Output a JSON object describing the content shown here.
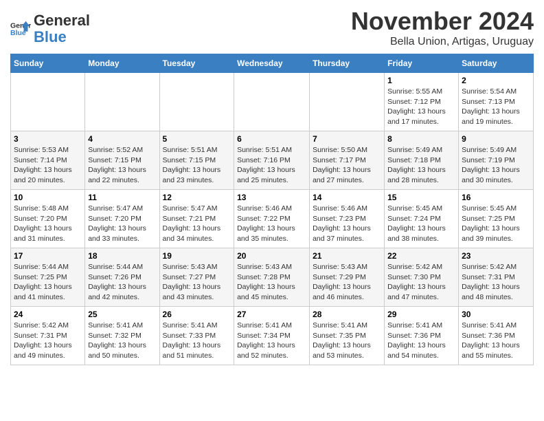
{
  "logo": {
    "general": "General",
    "blue": "Blue"
  },
  "header": {
    "month_title": "November 2024",
    "subtitle": "Bella Union, Artigas, Uruguay"
  },
  "days_of_week": [
    "Sunday",
    "Monday",
    "Tuesday",
    "Wednesday",
    "Thursday",
    "Friday",
    "Saturday"
  ],
  "weeks": [
    [
      {
        "day": "",
        "sunrise": "",
        "sunset": "",
        "daylight": ""
      },
      {
        "day": "",
        "sunrise": "",
        "sunset": "",
        "daylight": ""
      },
      {
        "day": "",
        "sunrise": "",
        "sunset": "",
        "daylight": ""
      },
      {
        "day": "",
        "sunrise": "",
        "sunset": "",
        "daylight": ""
      },
      {
        "day": "",
        "sunrise": "",
        "sunset": "",
        "daylight": ""
      },
      {
        "day": "1",
        "sunrise": "5:55 AM",
        "sunset": "7:12 PM",
        "daylight": "13 hours and 17 minutes."
      },
      {
        "day": "2",
        "sunrise": "5:54 AM",
        "sunset": "7:13 PM",
        "daylight": "13 hours and 19 minutes."
      }
    ],
    [
      {
        "day": "3",
        "sunrise": "5:53 AM",
        "sunset": "7:14 PM",
        "daylight": "13 hours and 20 minutes."
      },
      {
        "day": "4",
        "sunrise": "5:52 AM",
        "sunset": "7:15 PM",
        "daylight": "13 hours and 22 minutes."
      },
      {
        "day": "5",
        "sunrise": "5:51 AM",
        "sunset": "7:15 PM",
        "daylight": "13 hours and 23 minutes."
      },
      {
        "day": "6",
        "sunrise": "5:51 AM",
        "sunset": "7:16 PM",
        "daylight": "13 hours and 25 minutes."
      },
      {
        "day": "7",
        "sunrise": "5:50 AM",
        "sunset": "7:17 PM",
        "daylight": "13 hours and 27 minutes."
      },
      {
        "day": "8",
        "sunrise": "5:49 AM",
        "sunset": "7:18 PM",
        "daylight": "13 hours and 28 minutes."
      },
      {
        "day": "9",
        "sunrise": "5:49 AM",
        "sunset": "7:19 PM",
        "daylight": "13 hours and 30 minutes."
      }
    ],
    [
      {
        "day": "10",
        "sunrise": "5:48 AM",
        "sunset": "7:20 PM",
        "daylight": "13 hours and 31 minutes."
      },
      {
        "day": "11",
        "sunrise": "5:47 AM",
        "sunset": "7:20 PM",
        "daylight": "13 hours and 33 minutes."
      },
      {
        "day": "12",
        "sunrise": "5:47 AM",
        "sunset": "7:21 PM",
        "daylight": "13 hours and 34 minutes."
      },
      {
        "day": "13",
        "sunrise": "5:46 AM",
        "sunset": "7:22 PM",
        "daylight": "13 hours and 35 minutes."
      },
      {
        "day": "14",
        "sunrise": "5:46 AM",
        "sunset": "7:23 PM",
        "daylight": "13 hours and 37 minutes."
      },
      {
        "day": "15",
        "sunrise": "5:45 AM",
        "sunset": "7:24 PM",
        "daylight": "13 hours and 38 minutes."
      },
      {
        "day": "16",
        "sunrise": "5:45 AM",
        "sunset": "7:25 PM",
        "daylight": "13 hours and 39 minutes."
      }
    ],
    [
      {
        "day": "17",
        "sunrise": "5:44 AM",
        "sunset": "7:25 PM",
        "daylight": "13 hours and 41 minutes."
      },
      {
        "day": "18",
        "sunrise": "5:44 AM",
        "sunset": "7:26 PM",
        "daylight": "13 hours and 42 minutes."
      },
      {
        "day": "19",
        "sunrise": "5:43 AM",
        "sunset": "7:27 PM",
        "daylight": "13 hours and 43 minutes."
      },
      {
        "day": "20",
        "sunrise": "5:43 AM",
        "sunset": "7:28 PM",
        "daylight": "13 hours and 45 minutes."
      },
      {
        "day": "21",
        "sunrise": "5:43 AM",
        "sunset": "7:29 PM",
        "daylight": "13 hours and 46 minutes."
      },
      {
        "day": "22",
        "sunrise": "5:42 AM",
        "sunset": "7:30 PM",
        "daylight": "13 hours and 47 minutes."
      },
      {
        "day": "23",
        "sunrise": "5:42 AM",
        "sunset": "7:31 PM",
        "daylight": "13 hours and 48 minutes."
      }
    ],
    [
      {
        "day": "24",
        "sunrise": "5:42 AM",
        "sunset": "7:31 PM",
        "daylight": "13 hours and 49 minutes."
      },
      {
        "day": "25",
        "sunrise": "5:41 AM",
        "sunset": "7:32 PM",
        "daylight": "13 hours and 50 minutes."
      },
      {
        "day": "26",
        "sunrise": "5:41 AM",
        "sunset": "7:33 PM",
        "daylight": "13 hours and 51 minutes."
      },
      {
        "day": "27",
        "sunrise": "5:41 AM",
        "sunset": "7:34 PM",
        "daylight": "13 hours and 52 minutes."
      },
      {
        "day": "28",
        "sunrise": "5:41 AM",
        "sunset": "7:35 PM",
        "daylight": "13 hours and 53 minutes."
      },
      {
        "day": "29",
        "sunrise": "5:41 AM",
        "sunset": "7:36 PM",
        "daylight": "13 hours and 54 minutes."
      },
      {
        "day": "30",
        "sunrise": "5:41 AM",
        "sunset": "7:36 PM",
        "daylight": "13 hours and 55 minutes."
      }
    ]
  ]
}
